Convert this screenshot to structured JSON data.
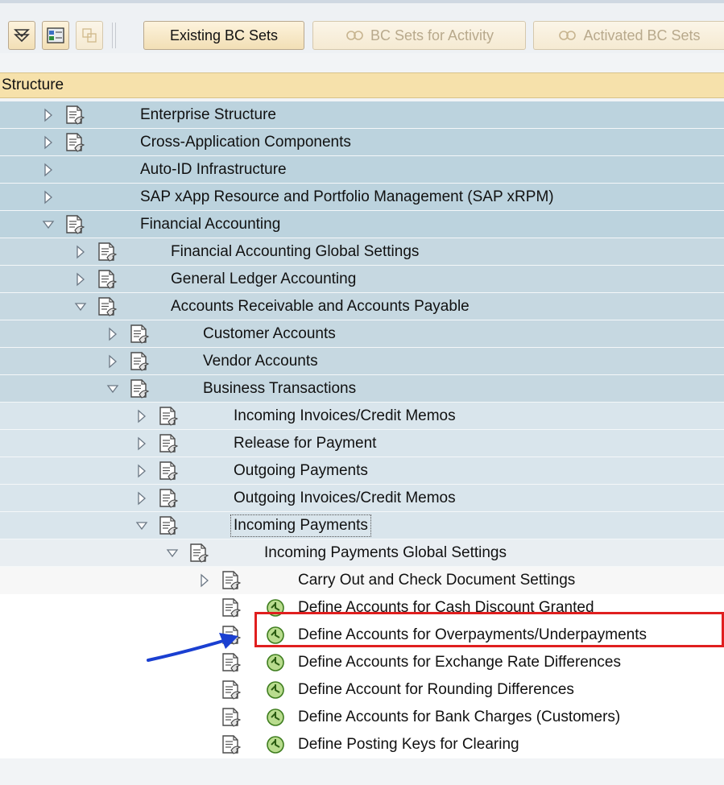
{
  "toolbar": {
    "existing_bc_sets": "Existing BC Sets",
    "bc_sets_for_activity": "BC Sets for Activity",
    "activated_bc_sets": "Activated BC Sets"
  },
  "structure": {
    "header": "Structure"
  },
  "tree": [
    {
      "label": "Enterprise Structure"
    },
    {
      "label": "Cross-Application Components"
    },
    {
      "label": "Auto-ID Infrastructure"
    },
    {
      "label": "SAP xApp Resource and Portfolio Management (SAP xRPM)"
    },
    {
      "label": "Financial Accounting"
    },
    {
      "label": "Financial Accounting Global Settings"
    },
    {
      "label": "General Ledger Accounting"
    },
    {
      "label": "Accounts Receivable and Accounts Payable"
    },
    {
      "label": "Customer Accounts"
    },
    {
      "label": "Vendor Accounts"
    },
    {
      "label": "Business Transactions"
    },
    {
      "label": "Incoming Invoices/Credit Memos"
    },
    {
      "label": "Release for Payment"
    },
    {
      "label": "Outgoing Payments"
    },
    {
      "label": "Outgoing Invoices/Credit Memos"
    },
    {
      "label": "Incoming Payments"
    },
    {
      "label": "Incoming Payments Global Settings"
    },
    {
      "label": "Carry Out and Check Document Settings"
    },
    {
      "label": "Define Accounts for Cash Discount Granted"
    },
    {
      "label": "Define Accounts for Overpayments/Underpayments"
    },
    {
      "label": "Define Accounts for Exchange Rate Differences"
    },
    {
      "label": "Define Account for Rounding Differences"
    },
    {
      "label": "Define Accounts for Bank Charges (Customers)"
    },
    {
      "label": "Define Posting Keys for Clearing"
    }
  ],
  "colors": {
    "header_bg": "#f6e1ab",
    "highlight_border": "#e01f1f",
    "arrow": "#1a3fd1"
  }
}
